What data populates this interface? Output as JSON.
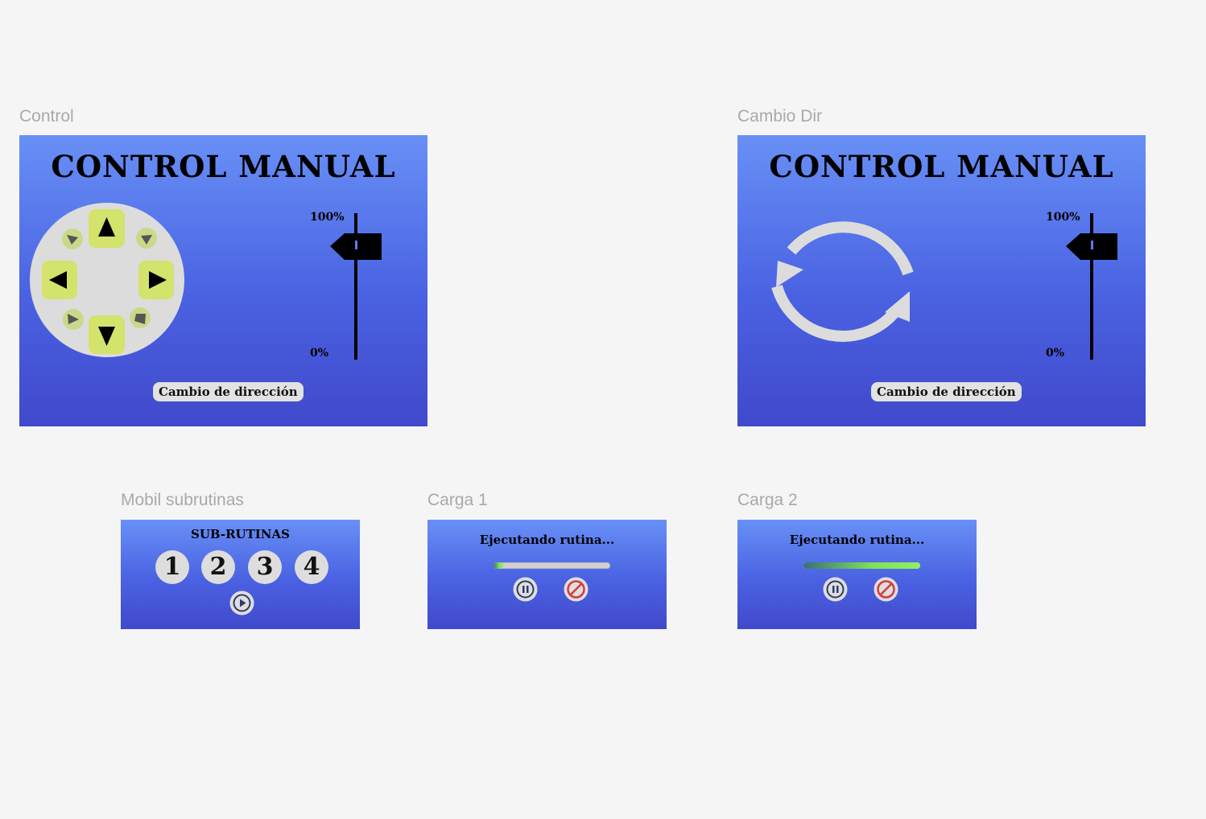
{
  "frames": {
    "control": {
      "label": "Control",
      "title": "CONTROL MANUAL",
      "scale_top": "100%",
      "scale_bottom": "0%",
      "button": "Cambio de dirección"
    },
    "cambio": {
      "label": "Cambio Dir",
      "title": "CONTROL MANUAL",
      "scale_top": "100%",
      "scale_bottom": "0%",
      "button": "Cambio de dirección"
    },
    "subrutinas": {
      "label": "Mobil subrutinas",
      "title": "SUB-RUTINAS",
      "numbers": [
        "1",
        "2",
        "3",
        "4"
      ]
    },
    "carga1": {
      "label": "Carga 1",
      "status": "Ejecutando rutina...",
      "progress": 0.08
    },
    "carga2": {
      "label": "Carga 2",
      "status": "Ejecutando rutina...",
      "progress": 1.0
    }
  },
  "colors": {
    "canvas": "#f5f5f5",
    "frame_top": "#6890f6",
    "frame_bottom": "#4049cb",
    "dpad_key": "#d3e36b",
    "dpad_base": "#dcdcdc",
    "cancel_icon": "#d63a3a"
  },
  "icons": [
    "arrow-up-icon",
    "arrow-down-icon",
    "arrow-left-icon",
    "arrow-right-icon",
    "rotate-arrows-icon",
    "slider-handle-icon",
    "play-icon",
    "pause-icon",
    "cancel-icon"
  ]
}
